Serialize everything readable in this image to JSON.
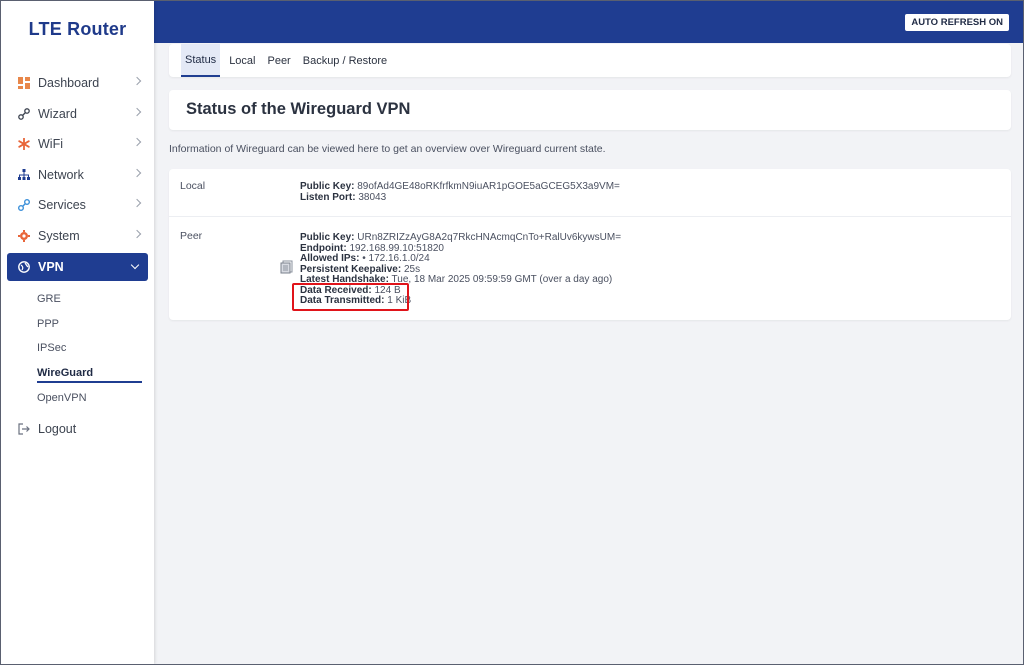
{
  "app": {
    "logo": "LTE Router"
  },
  "sidebar": {
    "items": [
      {
        "label": "Dashboard",
        "icon": "dashboard-icon"
      },
      {
        "label": "Wizard",
        "icon": "wizard-icon"
      },
      {
        "label": "WiFi",
        "icon": "wifi-icon"
      },
      {
        "label": "Network",
        "icon": "network-icon"
      },
      {
        "label": "Services",
        "icon": "services-icon"
      },
      {
        "label": "System",
        "icon": "gear-icon"
      },
      {
        "label": "VPN",
        "icon": "vpn-icon"
      }
    ],
    "vpn_sub": [
      {
        "label": "GRE"
      },
      {
        "label": "PPP"
      },
      {
        "label": "IPSec"
      },
      {
        "label": "WireGuard"
      },
      {
        "label": "OpenVPN"
      }
    ],
    "logout": "Logout"
  },
  "topbar": {
    "auto_refresh": "AUTO REFRESH ON"
  },
  "tabs": [
    {
      "label": "Status"
    },
    {
      "label": "Local"
    },
    {
      "label": "Peer"
    },
    {
      "label": "Backup / Restore"
    }
  ],
  "page": {
    "title": "Status of the Wireguard VPN",
    "description": "Information of Wireguard can be viewed here to get an overview over Wireguard current state."
  },
  "local": {
    "label": "Local",
    "public_key_label": "Public Key:",
    "public_key": "89ofAd4GE48oRKfrfkmN9iuAR1pGOE5aGCEG5X3a9VM=",
    "listen_port_label": "Listen Port:",
    "listen_port": "38043"
  },
  "peer": {
    "label": "Peer",
    "public_key_label": "Public Key:",
    "public_key": "URn8ZRIZzAyG8A2q7RkcHNAcmqCnTo+RalUv6kywsUM=",
    "endpoint_label": "Endpoint:",
    "endpoint": "192.168.99.10:51820",
    "allowed_ips_label": "Allowed IPs:",
    "allowed_ips": "• 172.16.1.0/24",
    "keepalive_label": "Persistent Keepalive:",
    "keepalive": "25s",
    "handshake_label": "Latest Handshake:",
    "handshake": "Tue, 18 Mar 2025 09:59:59 GMT (over a day ago)",
    "received_label": "Data Received:",
    "received": "124 B",
    "transmitted_label": "Data Transmitted:",
    "transmitted": "1 KiB"
  },
  "colors": {
    "brand": "#1f3d91",
    "highlight": "#e0141a",
    "background": "#f2f3f6"
  }
}
